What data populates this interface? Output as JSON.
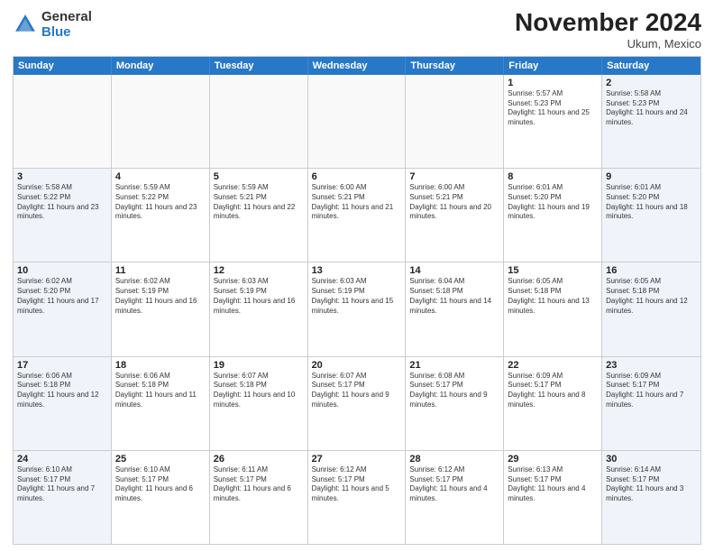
{
  "header": {
    "logo": {
      "general": "General",
      "blue": "Blue"
    },
    "title": "November 2024",
    "location": "Ukum, Mexico"
  },
  "calendar": {
    "days_of_week": [
      "Sunday",
      "Monday",
      "Tuesday",
      "Wednesday",
      "Thursday",
      "Friday",
      "Saturday"
    ],
    "rows": [
      [
        {
          "day": "",
          "empty": true
        },
        {
          "day": "",
          "empty": true
        },
        {
          "day": "",
          "empty": true
        },
        {
          "day": "",
          "empty": true
        },
        {
          "day": "",
          "empty": true
        },
        {
          "day": "1",
          "info": "Sunrise: 5:57 AM\nSunset: 5:23 PM\nDaylight: 11 hours and 25 minutes."
        },
        {
          "day": "2",
          "info": "Sunrise: 5:58 AM\nSunset: 5:23 PM\nDaylight: 11 hours and 24 minutes.",
          "weekend": true
        }
      ],
      [
        {
          "day": "3",
          "info": "Sunrise: 5:58 AM\nSunset: 5:22 PM\nDaylight: 11 hours and 23 minutes.",
          "weekend": true
        },
        {
          "day": "4",
          "info": "Sunrise: 5:59 AM\nSunset: 5:22 PM\nDaylight: 11 hours and 23 minutes."
        },
        {
          "day": "5",
          "info": "Sunrise: 5:59 AM\nSunset: 5:21 PM\nDaylight: 11 hours and 22 minutes."
        },
        {
          "day": "6",
          "info": "Sunrise: 6:00 AM\nSunset: 5:21 PM\nDaylight: 11 hours and 21 minutes."
        },
        {
          "day": "7",
          "info": "Sunrise: 6:00 AM\nSunset: 5:21 PM\nDaylight: 11 hours and 20 minutes."
        },
        {
          "day": "8",
          "info": "Sunrise: 6:01 AM\nSunset: 5:20 PM\nDaylight: 11 hours and 19 minutes."
        },
        {
          "day": "9",
          "info": "Sunrise: 6:01 AM\nSunset: 5:20 PM\nDaylight: 11 hours and 18 minutes.",
          "weekend": true
        }
      ],
      [
        {
          "day": "10",
          "info": "Sunrise: 6:02 AM\nSunset: 5:20 PM\nDaylight: 11 hours and 17 minutes.",
          "weekend": true
        },
        {
          "day": "11",
          "info": "Sunrise: 6:02 AM\nSunset: 5:19 PM\nDaylight: 11 hours and 16 minutes."
        },
        {
          "day": "12",
          "info": "Sunrise: 6:03 AM\nSunset: 5:19 PM\nDaylight: 11 hours and 16 minutes."
        },
        {
          "day": "13",
          "info": "Sunrise: 6:03 AM\nSunset: 5:19 PM\nDaylight: 11 hours and 15 minutes."
        },
        {
          "day": "14",
          "info": "Sunrise: 6:04 AM\nSunset: 5:18 PM\nDaylight: 11 hours and 14 minutes."
        },
        {
          "day": "15",
          "info": "Sunrise: 6:05 AM\nSunset: 5:18 PM\nDaylight: 11 hours and 13 minutes."
        },
        {
          "day": "16",
          "info": "Sunrise: 6:05 AM\nSunset: 5:18 PM\nDaylight: 11 hours and 12 minutes.",
          "weekend": true
        }
      ],
      [
        {
          "day": "17",
          "info": "Sunrise: 6:06 AM\nSunset: 5:18 PM\nDaylight: 11 hours and 12 minutes.",
          "weekend": true
        },
        {
          "day": "18",
          "info": "Sunrise: 6:06 AM\nSunset: 5:18 PM\nDaylight: 11 hours and 11 minutes."
        },
        {
          "day": "19",
          "info": "Sunrise: 6:07 AM\nSunset: 5:18 PM\nDaylight: 11 hours and 10 minutes."
        },
        {
          "day": "20",
          "info": "Sunrise: 6:07 AM\nSunset: 5:17 PM\nDaylight: 11 hours and 9 minutes."
        },
        {
          "day": "21",
          "info": "Sunrise: 6:08 AM\nSunset: 5:17 PM\nDaylight: 11 hours and 9 minutes."
        },
        {
          "day": "22",
          "info": "Sunrise: 6:09 AM\nSunset: 5:17 PM\nDaylight: 11 hours and 8 minutes."
        },
        {
          "day": "23",
          "info": "Sunrise: 6:09 AM\nSunset: 5:17 PM\nDaylight: 11 hours and 7 minutes.",
          "weekend": true
        }
      ],
      [
        {
          "day": "24",
          "info": "Sunrise: 6:10 AM\nSunset: 5:17 PM\nDaylight: 11 hours and 7 minutes.",
          "weekend": true
        },
        {
          "day": "25",
          "info": "Sunrise: 6:10 AM\nSunset: 5:17 PM\nDaylight: 11 hours and 6 minutes."
        },
        {
          "day": "26",
          "info": "Sunrise: 6:11 AM\nSunset: 5:17 PM\nDaylight: 11 hours and 6 minutes."
        },
        {
          "day": "27",
          "info": "Sunrise: 6:12 AM\nSunset: 5:17 PM\nDaylight: 11 hours and 5 minutes."
        },
        {
          "day": "28",
          "info": "Sunrise: 6:12 AM\nSunset: 5:17 PM\nDaylight: 11 hours and 4 minutes."
        },
        {
          "day": "29",
          "info": "Sunrise: 6:13 AM\nSunset: 5:17 PM\nDaylight: 11 hours and 4 minutes."
        },
        {
          "day": "30",
          "info": "Sunrise: 6:14 AM\nSunset: 5:17 PM\nDaylight: 11 hours and 3 minutes.",
          "weekend": true
        }
      ]
    ]
  }
}
